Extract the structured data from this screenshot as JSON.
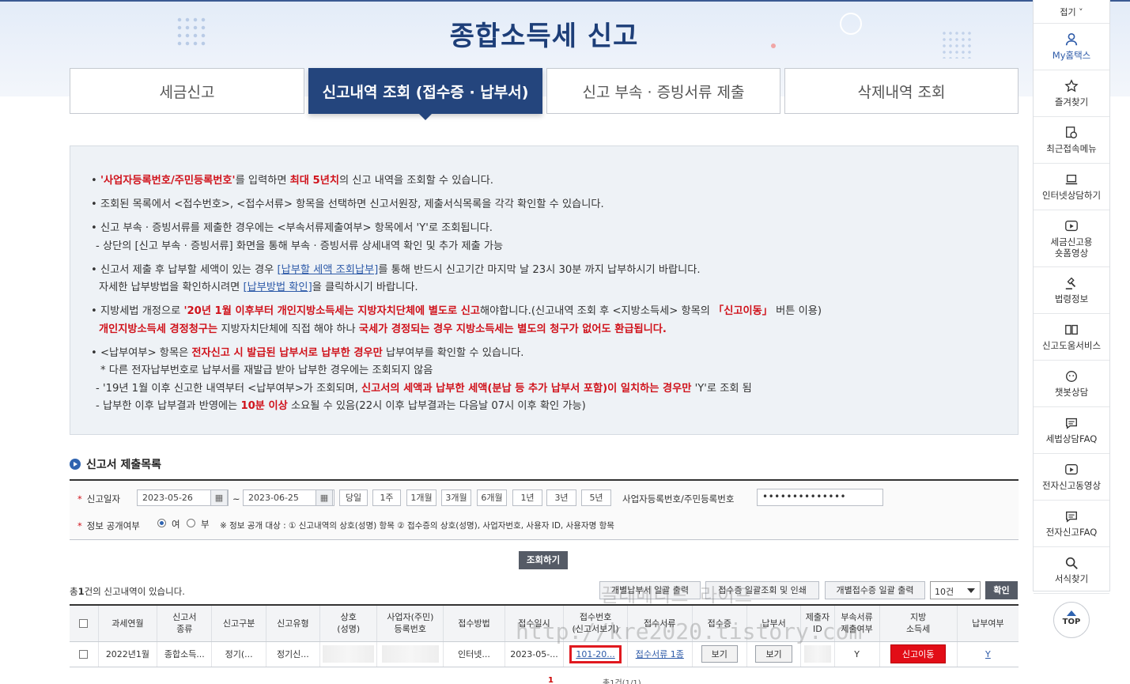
{
  "page": {
    "title": "종합소득세 신고"
  },
  "tabs": [
    {
      "label": "세금신고"
    },
    {
      "label": "신고내역 조회 (접수증 · 납부서)"
    },
    {
      "label": "신고 부속 · 증빙서류 제출"
    },
    {
      "label": "삭제내역 조회"
    }
  ],
  "notice": {
    "l1a": "'사업자등록번호/주민등록번호'",
    "l1b": "를 입력하면 ",
    "l1c": "최대 5년치",
    "l1d": "의 신고 내역을 조회할 수 있습니다.",
    "l2": "조회된 목록에서 <접수번호>, <접수서류> 항목을 선택하면 신고서원장, 제출서식목록을 각각 확인할 수 있습니다.",
    "l3": "신고 부속 · 증빙서류를 제출한 경우에는 <부속서류제출여부> 항목에서 'Y'로 조회됩니다.",
    "l3s": "- 상단의 [신고 부속 · 증빙서류] 화면을 통해 부속 · 증빙서류 상세내역 확인 및 추가 제출 가능",
    "l4a": "신고서 제출 후 납부할 세액이 있는 경우 ",
    "l4b": "[납부할 세액 조회납부]",
    "l4c": "를 통해 반드시 신고기간 마지막 날 23시 30분 까지 납부하시기 바랍니다.",
    "l4sa": "자세한 납부방법을 확인하시려면 ",
    "l4sb": "[납부방법 확인]",
    "l4sc": "을 클릭하시기 바랍니다.",
    "l5a": "지방세법 개정으로 ",
    "l5b": "'20년 1월 이후부터 개인지방소득세는 지방자치단체에 별도로 신고",
    "l5c": "해야합니다.(신고내역 조회 후 <지방소득세> 항목의 ",
    "l5d": "「신고이동」",
    "l5e": " 버튼 이용)",
    "l5sa": "개인지방소득세 경정청구는",
    "l5sb": " 지방자치단체에 직접 해야 하나 ",
    "l5sc": "국세가 경정되는 경우 지방소득세는 별도의 청구가 없어도 환급됩니다.",
    "l6a": "<납부여부> 항목은 ",
    "l6b": "전자신고 시 발급된 납부서로 납부한 경우만",
    "l6c": " 납부여부를 확인할 수 있습니다.",
    "l6s1": "* 다른 전자납부번호로 납부서를 재발급 받아 납부한 경우에는 조회되지 않음",
    "l6s2a": "- '19년 1월 이후 신고한 내역부터 <납부여부>가 조회되며, ",
    "l6s2b": "신고서의 세액과 납부한 세액(분납 등 추가 납부서 포함)이 일치하는 경우만",
    "l6s2c": " 'Y'로 조회 됨",
    "l6s3a": "- 납부한 이후 납부결과 반영에는 ",
    "l6s3b": "10분 이상",
    "l6s3c": " 소요될 수 있음(22시 이후 납부결과는 다음날 07시 이후 확인 가능)"
  },
  "section": {
    "title": "신고서 제출목록"
  },
  "search": {
    "date_label": "신고일자",
    "date_from": "2023-05-26",
    "date_to": "2023-06-25",
    "tilde": "~",
    "cal_icon": "▦",
    "periods": [
      "당일",
      "1주",
      "1개월",
      "3개월",
      "6개월",
      "1년",
      "3년",
      "5년"
    ],
    "id_label": "사업자등록번호/주민등록번호",
    "id_value": "••••••••••••••",
    "disclose_label": "정보 공개여부",
    "yes": "여",
    "no": "부",
    "disclose_note": "※ 정보 공개 대상 : ① 신고내역의 상호(성명) 항목 ② 접수증의 상호(성명), 사업자번호, 사용자 ID, 사용자명 항목",
    "query_button": "조회하기"
  },
  "results": {
    "count_pre": "총",
    "count": "1",
    "count_post": "건의 신고내역이 있습니다.",
    "btn_bulk_pay": "개별납부서 일괄 출력",
    "btn_bulk_receipt": "접수증 일괄조회 및 인쇄",
    "btn_bulk_each": "개별접수증 일괄 출력",
    "page_size": "10건",
    "ok": "확인",
    "headers": [
      "과세연월",
      "신고서\n종류",
      "신고구분",
      "신고유형",
      "상호\n(성명)",
      "사업자(주민)\n등록번호",
      "접수방법",
      "접수일시",
      "접수번호\n(신고서보기)",
      "접수서류",
      "접수증",
      "납부서",
      "제출자\nID",
      "부속서류\n제출여부",
      "지방\n소득세",
      "납부여부"
    ],
    "row": {
      "period": "2022년1월",
      "kind": "종합소득...",
      "division": "정기(...",
      "type": "정기신...",
      "method": "인터넷...",
      "date": "2023-05-...",
      "receipt_no": "101-20...",
      "docs": "접수서류 1종",
      "view1": "보기",
      "view2": "보기",
      "attached": "Y",
      "local_btn": "신고이동",
      "paid": "Y"
    },
    "page_current": "1",
    "page_info": "총1건(1/1)"
  },
  "watermark": {
    "l1": "끌레메리드 라이프",
    "l2": "http://kre2020.tistory.com"
  },
  "quickmenu": {
    "fold": "접기 ˅",
    "items": [
      "My홈택스",
      "즐겨찾기",
      "최근접속메뉴",
      "인터넷상담하기",
      "세금신고용\n숏폼영상",
      "법령정보",
      "신고도움서비스",
      "챗봇상담",
      "세법상담FAQ",
      "전자신고동영상",
      "전자신고FAQ",
      "서식찾기"
    ],
    "top": "TOP"
  }
}
